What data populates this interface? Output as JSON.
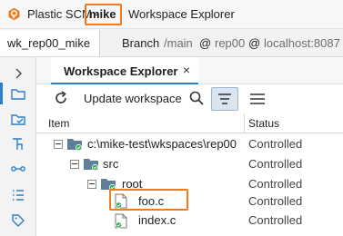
{
  "colors": {
    "accent": "#f07c22",
    "selection": "#2a7fc9",
    "controlled_badge": "#2fa84f",
    "folder": "#5f7f99"
  },
  "titlebar": {
    "app_name": "Plastic SCM -",
    "user": "mike",
    "window_title": "Workspace Explorer",
    "logo_icon": "plastic-logo-icon"
  },
  "workspace_bar": {
    "workspace": "wk_rep00_mike",
    "branch_label": "Branch",
    "branch": "/main",
    "at1": "@",
    "repo": "rep00",
    "at2": "@",
    "server": "localhost:8087"
  },
  "sidebar": {
    "items": [
      {
        "icon": "chevron-right-icon"
      },
      {
        "icon": "folder-icon",
        "active": true
      },
      {
        "icon": "pending-changes-icon"
      },
      {
        "icon": "branches-icon"
      },
      {
        "icon": "changesets-icon"
      },
      {
        "icon": "list-icon"
      },
      {
        "icon": "tag-icon"
      }
    ]
  },
  "tabs": [
    {
      "label": "Workspace Explorer",
      "close": "×"
    }
  ],
  "toolbar": {
    "update_label": "Update workspace",
    "refresh_icon": "refresh-icon",
    "search_icon": "search-icon",
    "tree_view_icon": "tree-view-icon",
    "list_view_icon": "list-view-icon"
  },
  "table": {
    "columns": [
      "Item",
      "Status"
    ],
    "rows": [
      {
        "name": "c:\\mike-test\\wkspaces\\rep00",
        "status": "Controlled",
        "type": "folder",
        "depth": 0
      },
      {
        "name": "src",
        "status": "Controlled",
        "type": "folder",
        "depth": 1
      },
      {
        "name": "root",
        "status": "Controlled",
        "type": "folder",
        "depth": 2
      },
      {
        "name": "foo.c",
        "status": "Controlled",
        "type": "file",
        "depth": 3
      },
      {
        "name": "index.c",
        "status": "Controlled",
        "type": "file",
        "depth": 3
      }
    ]
  }
}
